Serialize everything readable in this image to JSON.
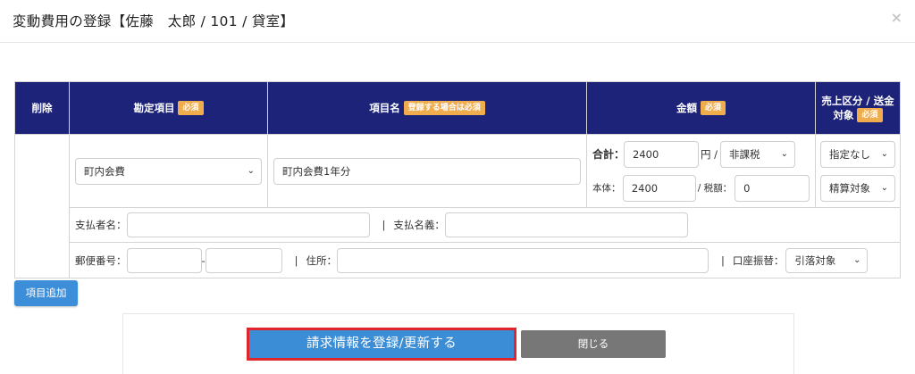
{
  "modal": {
    "title": "変動費用の登録【佐藤　太郎 / 101 / 貸室】",
    "close_glyph": "×"
  },
  "table": {
    "headers": {
      "delete": "削除",
      "account": "勘定項目",
      "item_name": "項目名",
      "amount": "金額",
      "sales_type_line1": "売上区分 / 送金",
      "sales_type_line2": "対象"
    },
    "badges": {
      "required": "必須",
      "required_if_register": "登録する場合は必須"
    },
    "row": {
      "account_value": "町内会費",
      "item_name_value": "町内会費1年分",
      "total_label": "合計：",
      "total_value": "2400",
      "yen_label": "円 /",
      "tax_type_value": "非課税",
      "base_label": "本体：",
      "base_value": "2400",
      "tax_label": "/ 税額：",
      "tax_value": "0",
      "sales_type_value": "指定なし",
      "remit_target_value": "精算対象"
    },
    "payer": {
      "payer_name_label": "支払者名：",
      "payer_name_value": "",
      "separator": "|",
      "payee_label": "支払名義：",
      "payee_value": ""
    },
    "address": {
      "postal_label": "郵便番号：",
      "postal_part1": "",
      "postal_dash": "-",
      "postal_part2": "",
      "separator1": "|",
      "address_label": "住所：",
      "address_value": "",
      "separator2": "|",
      "transfer_label": "口座振替：",
      "transfer_value": "引落対象"
    }
  },
  "actions": {
    "add_item": "項目追加",
    "submit": "請求情報を登録/更新する",
    "close": "閉じる"
  },
  "colors": {
    "header_bg": "#1c2379",
    "badge": "#f0ad4e",
    "primary": "#3b8dd6",
    "highlight_border": "#e0252b",
    "secondary_button": "#777777"
  }
}
